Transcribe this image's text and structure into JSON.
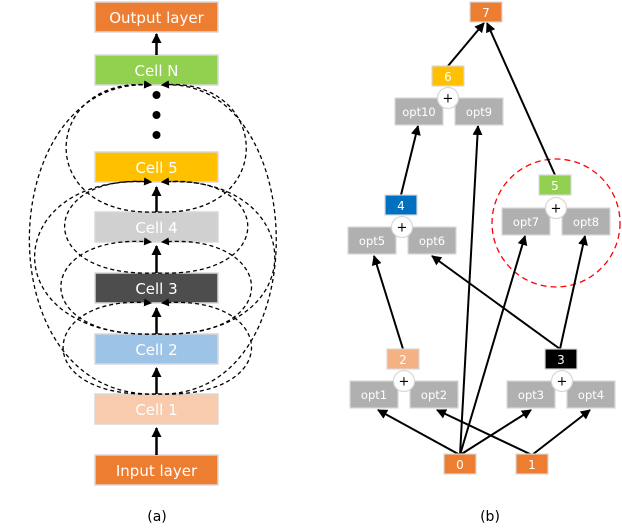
{
  "panel_a": {
    "caption": "(a)",
    "boxes": [
      {
        "id": "output",
        "label": "Output layer",
        "color": "#ED7D31",
        "text": "#ffffff"
      },
      {
        "id": "cellN",
        "label": "Cell N",
        "color": "#92D050",
        "text": "#ffffff"
      },
      {
        "id": "cell5",
        "label": "Cell 5",
        "color": "#FFC000",
        "text": "#ffffff"
      },
      {
        "id": "cell4",
        "label": "Cell 4",
        "color": "#D0D0D0",
        "text": "#ffffff"
      },
      {
        "id": "cell3",
        "label": "Cell 3",
        "color": "#4D4D4D",
        "text": "#ffffff"
      },
      {
        "id": "cell2",
        "label": "Cell 2",
        "color": "#9DC3E6",
        "text": "#ffffff"
      },
      {
        "id": "cell1",
        "label": "Cell 1",
        "color": "#F8CBAD",
        "text": "#ffffff"
      },
      {
        "id": "input",
        "label": "Input layer",
        "color": "#ED7D31",
        "text": "#ffffff"
      }
    ]
  },
  "panel_b": {
    "caption": "(b)",
    "plus": "+",
    "nodes": [
      {
        "id": "n0",
        "label": "0",
        "color": "#ED7D31"
      },
      {
        "id": "n1",
        "label": "1",
        "color": "#ED7D31"
      },
      {
        "id": "n2",
        "label": "2",
        "color": "#F4B183"
      },
      {
        "id": "n3",
        "label": "3",
        "color": "#000000"
      },
      {
        "id": "n4",
        "label": "4",
        "color": "#0070C0"
      },
      {
        "id": "n5",
        "label": "5",
        "color": "#92D050"
      },
      {
        "id": "n6",
        "label": "6",
        "color": "#FFC000"
      },
      {
        "id": "n7",
        "label": "7",
        "color": "#ED7D31"
      }
    ],
    "ops": [
      "opt1",
      "opt2",
      "opt3",
      "opt4",
      "opt5",
      "opt6",
      "opt7",
      "opt8",
      "opt9",
      "opt10"
    ],
    "op_color": "#B0B0B0",
    "highlight_color": "#FF0000"
  }
}
